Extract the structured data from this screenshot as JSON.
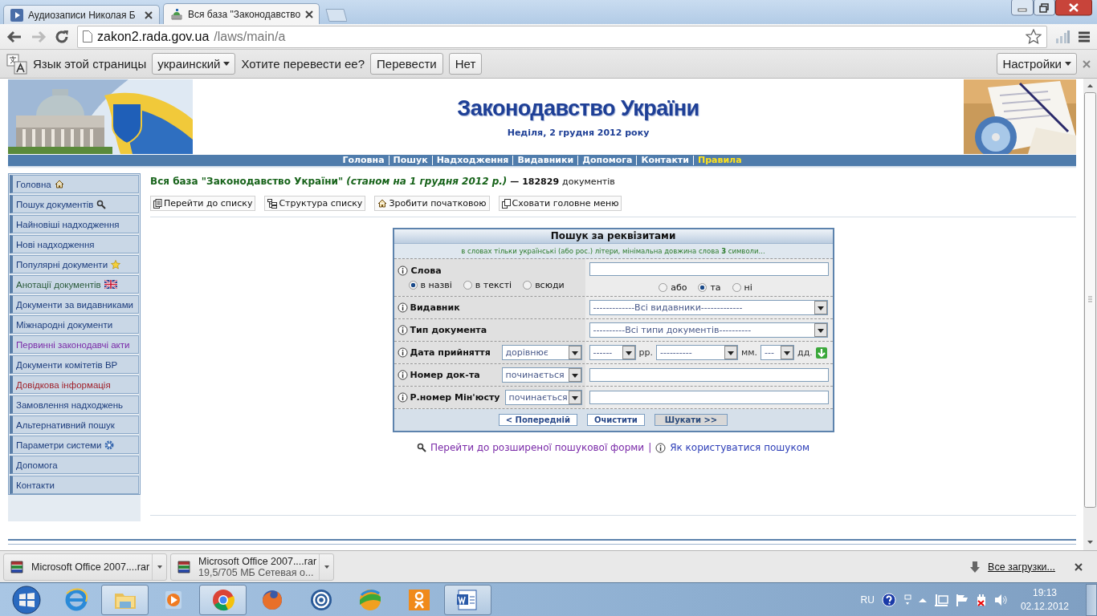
{
  "browser": {
    "tabs": [
      {
        "title": "Аудиозаписи Николая Б",
        "kind": "play",
        "selected": false
      },
      {
        "title": "Вся база \"Законодавство",
        "kind": "building",
        "selected": true
      }
    ],
    "url_host": "zakon2.rada.gov.ua",
    "url_path": "/laws/main/a"
  },
  "translate_bar": {
    "prompt": "Язык этой страницы",
    "language": "украинский",
    "question": "Хотите перевести ее?",
    "buttons": [
      "Перевести",
      "Нет"
    ],
    "settings": "Настройки"
  },
  "site": {
    "title": "Законодавство України",
    "date": "Неділя, 2 грудня 2012 року",
    "nav": [
      {
        "label": "Головна",
        "highlighted": false
      },
      {
        "label": "Пошук",
        "highlighted": false
      },
      {
        "label": "Надходження",
        "highlighted": false
      },
      {
        "label": "Видавники",
        "highlighted": false
      },
      {
        "label": "Допомога",
        "highlighted": false
      },
      {
        "label": "Контакти",
        "highlighted": false
      },
      {
        "label": "Правила",
        "highlighted": true
      }
    ]
  },
  "sidebar": {
    "items": [
      {
        "label": "Головна",
        "kind": "home",
        "color": "#1c3c7c"
      },
      {
        "label": "Пошук документів",
        "kind": "search",
        "color": "#1c3c7c"
      },
      {
        "label": "Найновіші надходження",
        "color": "#1c3c7c"
      },
      {
        "label": "Нові надходження",
        "color": "#1c3c7c"
      },
      {
        "label": "Популярні документи",
        "kind": "star",
        "color": "#1c3c7c"
      },
      {
        "label": "Анотації документів",
        "kind": "flag",
        "color": "#2a5a3a"
      },
      {
        "label": "Документи за видавниками",
        "color": "#1c3c7c"
      },
      {
        "label": "Міжнародні документи",
        "color": "#1c3c7c"
      },
      {
        "label": "Первинні законодавчі акти",
        "color": "#7a2aa8"
      },
      {
        "label": "Документи комітетів ВР",
        "color": "#1c3c7c"
      },
      {
        "label": "Довідкова інформація",
        "color": "#a0202a"
      },
      {
        "label": "Замовлення надходжень",
        "color": "#1c3c7c"
      },
      {
        "label": "Альтернативний пошук",
        "color": "#1c3c7c"
      },
      {
        "label": "Параметри системи",
        "kind": "gear",
        "color": "#1c3c7c"
      },
      {
        "label": "Допомога",
        "color": "#1c3c7c"
      },
      {
        "label": "Контакти",
        "color": "#1c3c7c"
      }
    ]
  },
  "content": {
    "heading": "Вся база \"Законодавство України\"",
    "heading_note": "(станом на 1 грудня 2012 р.)",
    "count": "— 182829",
    "count_unit": "документів",
    "tools": [
      {
        "label": "Перейти до списку",
        "kind": "list"
      },
      {
        "label": "Структура списку",
        "kind": "tree"
      },
      {
        "label": "Зробити початковою",
        "kind": "home"
      },
      {
        "label": "Сховати головне меню",
        "kind": "pages"
      }
    ]
  },
  "search_form": {
    "title": "Пошук за реквізитами",
    "hint": "в словах тільки українські (або рос.) літери, мінімальна довжина слова **3** символи...",
    "rows": [
      {
        "kind": "words",
        "label": "Слова",
        "scope": [
          {
            "label": "в назві",
            "selected": true
          },
          {
            "label": "в тексті",
            "selected": false
          },
          {
            "label": "всюди",
            "selected": false
          }
        ],
        "logic": [
          {
            "label": "або",
            "selected": false
          },
          {
            "label": "та",
            "selected": true
          },
          {
            "label": "ні",
            "selected": false
          }
        ]
      },
      {
        "kind": "select",
        "label": "Видавник",
        "value": "-------------Всі видавники-------------"
      },
      {
        "kind": "select",
        "label": "Тип документа",
        "value": "----------Всі типи документів----------"
      },
      {
        "kind": "date",
        "label": "Дата прийняття",
        "mode": "дорівнює",
        "year": "------",
        "year_unit": "рр.",
        "month": "----------",
        "month_unit": "мм.",
        "day": "---",
        "day_unit": "дд."
      },
      {
        "kind": "text",
        "label": "Номер док-та",
        "mode": "починається"
      },
      {
        "kind": "text",
        "label": "Р.номер Мін'юсту",
        "mode": "починається"
      }
    ],
    "buttons": [
      {
        "label": "< Попередній",
        "default": false
      },
      {
        "label": "Очистити",
        "default": false
      },
      {
        "label": "Шукати >>",
        "default": true
      }
    ],
    "links": {
      "advanced": "Перейти до розширеної пошукової форми",
      "separator": "|",
      "help": "Як користуватися пошуком"
    }
  },
  "downloads": {
    "items": [
      {
        "name": "Microsoft Office 2007....rar"
      },
      {
        "name": "Microsoft Office 2007....rar",
        "status": "19,5/705 МБ Сетевая о..."
      }
    ],
    "all": "Все загрузки..."
  },
  "taskbar": {
    "apps": [
      {
        "kind": "ie",
        "open": false
      },
      {
        "kind": "explorer",
        "open": true
      },
      {
        "kind": "media",
        "open": false
      },
      {
        "kind": "chrome",
        "open": true
      },
      {
        "kind": "firefox",
        "open": false
      },
      {
        "kind": "mail",
        "open": false
      },
      {
        "kind": "sphere",
        "open": false
      },
      {
        "kind": "ok",
        "open": false
      },
      {
        "kind": "word",
        "open": true
      }
    ],
    "lang": "RU",
    "time": "19:13",
    "date": "02.12.2012"
  }
}
